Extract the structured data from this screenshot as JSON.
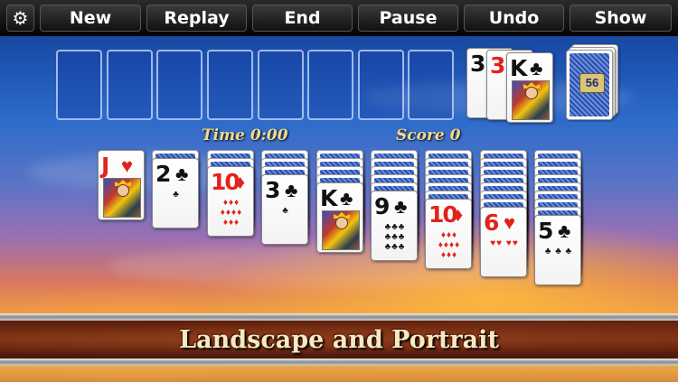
{
  "toolbar": {
    "settings_icon": "gear-icon",
    "new_label": "New",
    "replay_label": "Replay",
    "end_label": "End",
    "pause_label": "Pause",
    "undo_label": "Undo",
    "show_label": "Show"
  },
  "waste": [
    {
      "rank": "3",
      "suit": "♣",
      "color": "black"
    },
    {
      "rank": "3",
      "suit": "♥",
      "color": "red"
    },
    {
      "rank": "K",
      "suit": "♣",
      "color": "black"
    }
  ],
  "stock": {
    "count": "56"
  },
  "hud": {
    "time": "Time 0:00",
    "score": "Score 0"
  },
  "tableau": [
    {
      "rank": "J",
      "suit": "♥",
      "color": "red",
      "face": true,
      "pips": ""
    },
    {
      "rank": "2",
      "suit": "♣",
      "color": "black",
      "face": false,
      "pips": "♣"
    },
    {
      "rank": "10",
      "suit": "♦",
      "color": "red",
      "face": false,
      "pips": "♦♦♦ ♦♦♦♦ ♦♦♦"
    },
    {
      "rank": "3",
      "suit": "♣",
      "color": "black",
      "face": false,
      "pips": "♣"
    },
    {
      "rank": "K",
      "suit": "♣",
      "color": "black",
      "face": true,
      "pips": ""
    },
    {
      "rank": "9",
      "suit": "♣",
      "color": "black",
      "face": false,
      "pips": "♣♣♣ ♣♣♣ ♣♣♣"
    },
    {
      "rank": "10",
      "suit": "♦",
      "color": "red",
      "face": false,
      "pips": "♦♦♦ ♦♦♦♦ ♦♦♦"
    },
    {
      "rank": "6",
      "suit": "♥",
      "color": "red",
      "face": false,
      "pips": "♥♥ ♥♥"
    },
    {
      "rank": "5",
      "suit": "♣",
      "color": "black",
      "face": false,
      "pips": "♣ ♣ ♣"
    }
  ],
  "banner": {
    "text": "Landscape and Portrait"
  }
}
